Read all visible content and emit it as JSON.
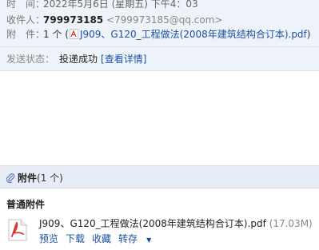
{
  "header": {
    "time_label": "时　间：",
    "time_value": "2022年5月6日 (星期五) 下午4：03",
    "recipient_label": "收件人：",
    "recipient_name": "799973185",
    "recipient_email": "<799973185@qq.com>",
    "attachment_label": "附　件：",
    "attachment_count": "1 个 (",
    "attachment_file": "J909、G120_工程做法(2008年建筑结构合订本).pdf",
    "attachment_close": ")"
  },
  "status": {
    "label": "发送状态：",
    "value": "投递成功",
    "detail_link": "[查看详情]"
  },
  "attachments": {
    "title": "附件",
    "count": "(1 个)",
    "section_title": "普通附件",
    "file": {
      "name": "J909、G120_工程做法(2008年建筑结构合订本).pdf",
      "size": "(17.03M)",
      "actions": {
        "preview": "预览",
        "download": "下载",
        "favorite": "收藏",
        "forward": "转存"
      }
    }
  },
  "colors": {
    "header_bg": "#eef2f9",
    "link": "#1c4fa1",
    "pdf_red": "#d9342b"
  }
}
